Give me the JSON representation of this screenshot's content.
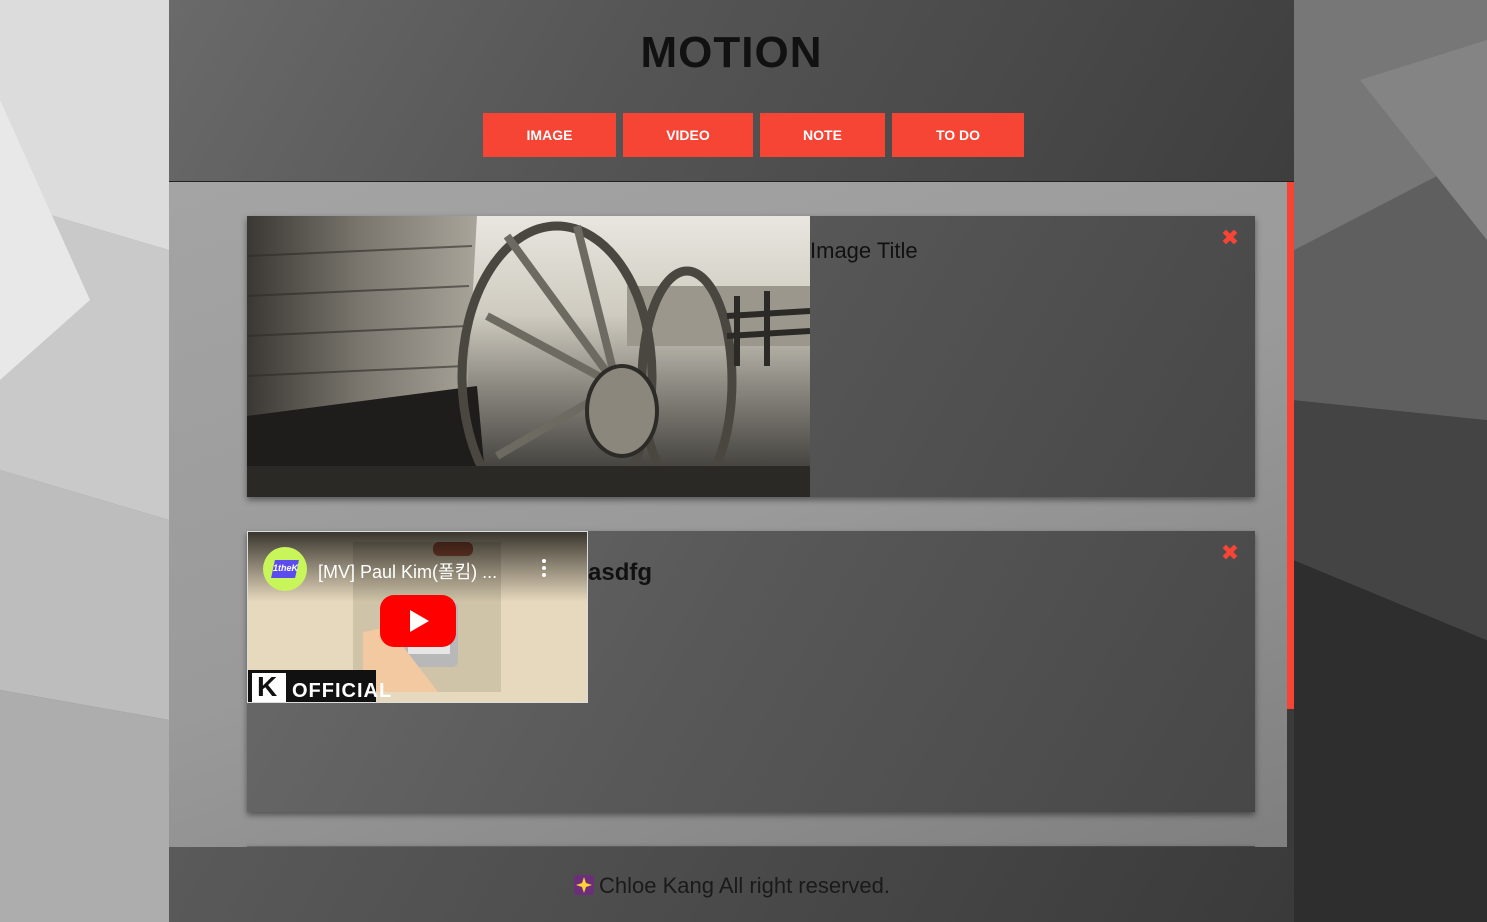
{
  "header": {
    "title": "MOTION",
    "nav": [
      {
        "label": "IMAGE"
      },
      {
        "label": "VIDEO"
      },
      {
        "label": "NOTE"
      },
      {
        "label": "TO DO"
      }
    ]
  },
  "cards": [
    {
      "type": "image",
      "title": "Image Title",
      "close_icon": "close-x-icon"
    },
    {
      "type": "video",
      "title": "asdfg",
      "close_icon": "close-x-icon",
      "video": {
        "title": "[MV] Paul Kim(폴킴) ...",
        "channel_badge": "1theK",
        "watermark": "OFFICIAL",
        "play_icon": "youtube-play-icon",
        "menu_icon": "kebab-menu-icon"
      }
    }
  ],
  "footer": {
    "icon": "sparkle-icon",
    "text": "Chloe Kang All right reserved."
  },
  "colors": {
    "accent": "#f64435",
    "header_bg": "#555555"
  }
}
